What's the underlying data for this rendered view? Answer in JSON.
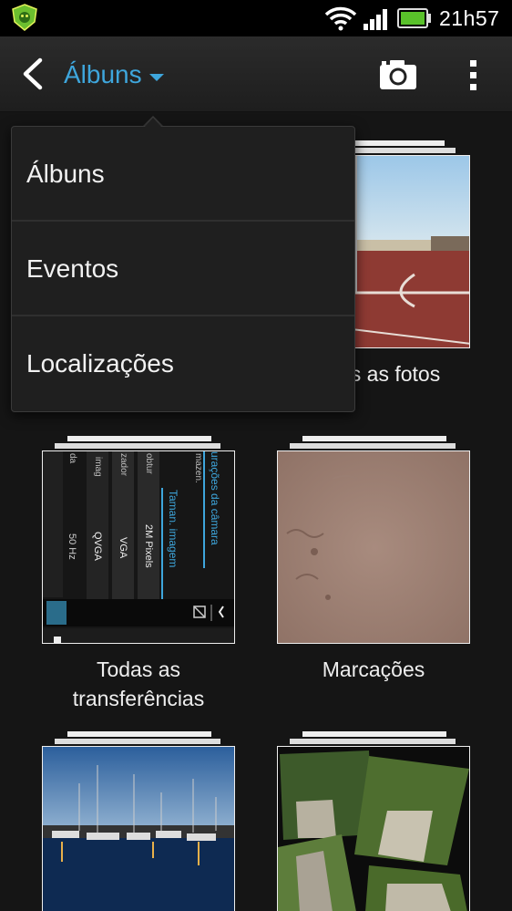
{
  "status_bar": {
    "time": "21h57",
    "app_icon": "shield-app-icon",
    "wifi_icon": "wifi-icon",
    "signal_icon": "signal-icon",
    "battery_icon": "battery-icon"
  },
  "action_bar": {
    "title": "Álbuns",
    "back_icon": "chevron-left-icon",
    "camera_icon": "camera-icon",
    "menu_icon": "overflow-menu-icon",
    "accent_color": "#3ea6dc"
  },
  "dropdown": {
    "items": [
      {
        "label": "Álbuns"
      },
      {
        "label": "Eventos"
      },
      {
        "label": "Localizações"
      }
    ]
  },
  "albums": [
    {
      "label": "Todas as fotos",
      "visible_label": "s as fotos",
      "thumb": "outdoor-court-photo"
    },
    {
      "label_line1": "Todas as",
      "label_line2": "transferências",
      "thumb": "camera-settings-screenshot",
      "thumb_text": {
        "settings_title": "urações da câmara",
        "image_size": "Taman. imagem",
        "options": [
          "2M Pixels",
          "VGA",
          "QVGA"
        ],
        "col_labels": [
          "imag",
          "zador",
          "obtur",
          "mazen."
        ],
        "freq": "50 Hz",
        "side_label": "da"
      }
    },
    {
      "label": "Marcações",
      "thumb": "sand-photo"
    },
    {
      "label": "",
      "thumb": "marina-night-photo"
    },
    {
      "label": "",
      "thumb": "park-collage-photo"
    }
  ]
}
